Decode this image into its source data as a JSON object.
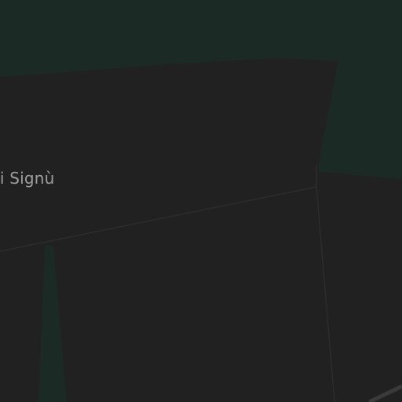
{
  "map": {
    "place_label": "ni Signù",
    "colors": {
      "land": "#212121",
      "green_area": "#1b2a25",
      "boundary": "#303030",
      "road": "#3a3a3a",
      "label": "#9e9e9e"
    }
  }
}
